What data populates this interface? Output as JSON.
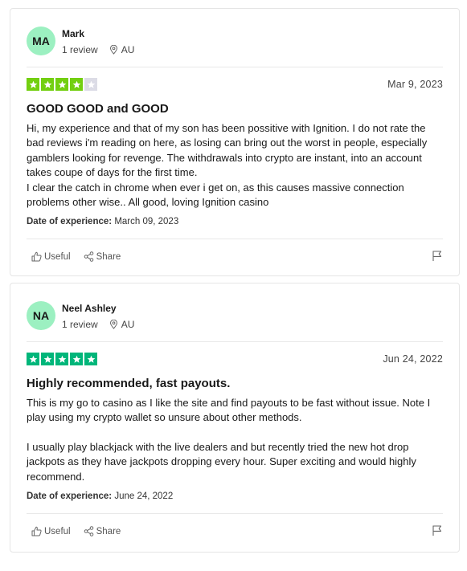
{
  "reviews": [
    {
      "avatar_initials": "MA",
      "reviewer_name": "Mark",
      "review_count": "1 review",
      "country": "AU",
      "rating": 4,
      "rating_max": 5,
      "rating_color": "#73cf11",
      "date": "Mar 9, 2023",
      "title": "GOOD GOOD and GOOD",
      "body": [
        "Hi, my experience and that of my son has been possitive with Ignition. I do not rate the bad reviews i'm reading on here, as losing can bring out the worst in people, especially gamblers looking for revenge. The withdrawals into crypto are instant, into an account takes coupe of days for the first time.",
        "I clear the catch in chrome when ever i get on, as this causes massive connection problems other wise.. All good, loving Ignition casino"
      ],
      "experience_label": "Date of experience:",
      "experience_date": "March 09, 2023",
      "useful_label": "Useful",
      "share_label": "Share"
    },
    {
      "avatar_initials": "NA",
      "reviewer_name": "Neel Ashley",
      "review_count": "1 review",
      "country": "AU",
      "rating": 5,
      "rating_max": 5,
      "rating_color": "#00b67a",
      "date": "Jun 24, 2022",
      "title": "Highly recommended, fast payouts.",
      "body": [
        "This is my go to casino as I like the site and find payouts to be fast without issue. Note I play using my crypto wallet so unsure about other methods.",
        "I usually play blackjack with the live dealers and but recently tried the new hot drop jackpots as they have jackpots dropping every hour. Super exciting and would highly recommend."
      ],
      "experience_label": "Date of experience:",
      "experience_date": "June 24, 2022",
      "useful_label": "Useful",
      "share_label": "Share"
    }
  ],
  "icons": {
    "location": "location-pin-icon",
    "useful": "thumbs-up-icon",
    "share": "share-icon",
    "flag": "flag-icon",
    "star": "star-icon"
  }
}
